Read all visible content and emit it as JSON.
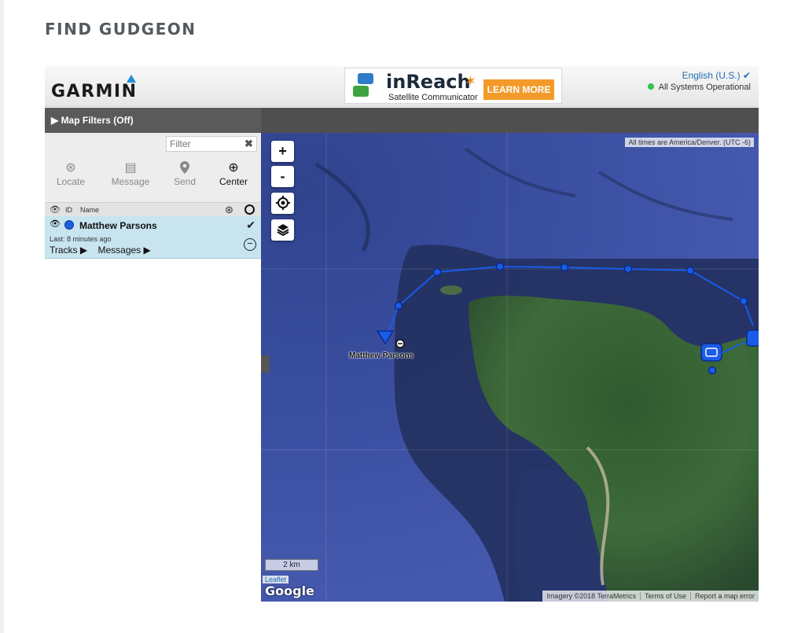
{
  "page": {
    "heading": "FIND GUDGEON"
  },
  "header": {
    "logo": "GARMIN",
    "ad": {
      "brand": "inReach",
      "subtitle": "Satellite Communicator",
      "cta": "LEARN MORE"
    },
    "language": "English (U.S.) ✔",
    "status": "All Systems Operational",
    "status_color": "#35c24a"
  },
  "panel": {
    "filters_label": "▶ Map Filters (Off)",
    "filter_placeholder": "Filter",
    "filter_clear": "✖",
    "tools": [
      {
        "label": "Locate",
        "icon": "locate-icon",
        "glyph": "⊛"
      },
      {
        "label": "Message",
        "icon": "message-icon",
        "glyph": "▤"
      },
      {
        "label": "Send",
        "icon": "send-pin-icon",
        "glyph": "⬤"
      },
      {
        "label": "Center",
        "icon": "center-crosshair-icon",
        "glyph": "⊕"
      }
    ],
    "columns": {
      "id": "ID",
      "name": "Name"
    },
    "contact": {
      "name": "Matthew Parsons",
      "last": "Last: 8 minutes ago",
      "tracks": "Tracks ▶",
      "messages": "Messages ▶",
      "color": "#1f5fe0"
    }
  },
  "map": {
    "zoom_in": "+",
    "zoom_out": "-",
    "timezone_note": "All times are America/Denver. (UTC -6)",
    "scale": "2 km",
    "leaflet": "Leaflet",
    "google": "Google",
    "attribution": [
      "Imagery ©2018 TerraMetrics",
      "Terms of Use",
      "Report a map error"
    ],
    "marker_label": "Matthew Parsons",
    "track_color": "#1a5bea"
  }
}
